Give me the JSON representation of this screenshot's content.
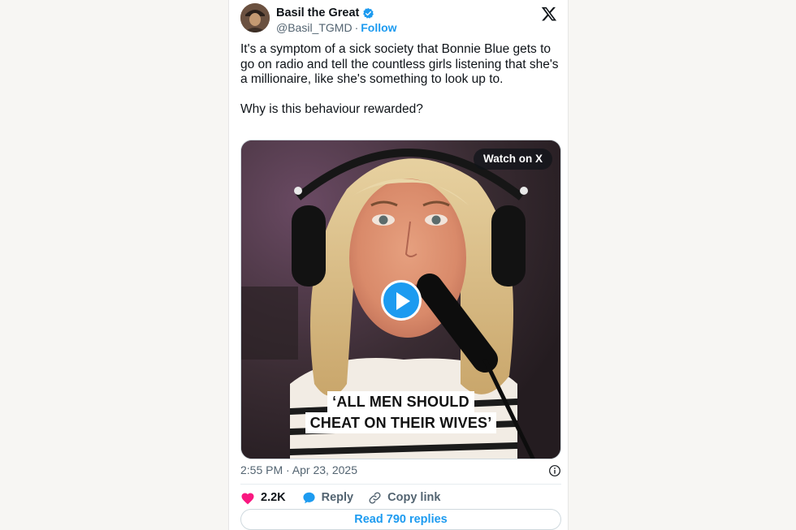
{
  "author": {
    "display_name": "Basil the Great",
    "handle": "@Basil_TGMD",
    "separator": "·",
    "follow_label": "Follow",
    "verified": true,
    "avatar_icon": "avatar-photo"
  },
  "tweet": {
    "text": "It's a symptom of a sick society that Bonnie Blue gets to go on radio and tell the countless girls listening that she's a millionaire, like she's something to look up to.\n\nWhy is this behaviour rewarded?",
    "timestamp": "2:55 PM · Apr 23, 2025"
  },
  "media": {
    "watch_label": "Watch on X",
    "caption_line1": "‘ALL MEN SHOULD",
    "caption_line2": "CHEAT ON THEIR WIVES’"
  },
  "actions": {
    "like_count": "2.2K",
    "reply_label": "Reply",
    "copy_label": "Copy link",
    "read_replies_label": "Read 790 replies"
  },
  "colors": {
    "accent": "#1d9bf0",
    "like": "#f91880",
    "text": "#0f1419",
    "muted": "#536471"
  }
}
